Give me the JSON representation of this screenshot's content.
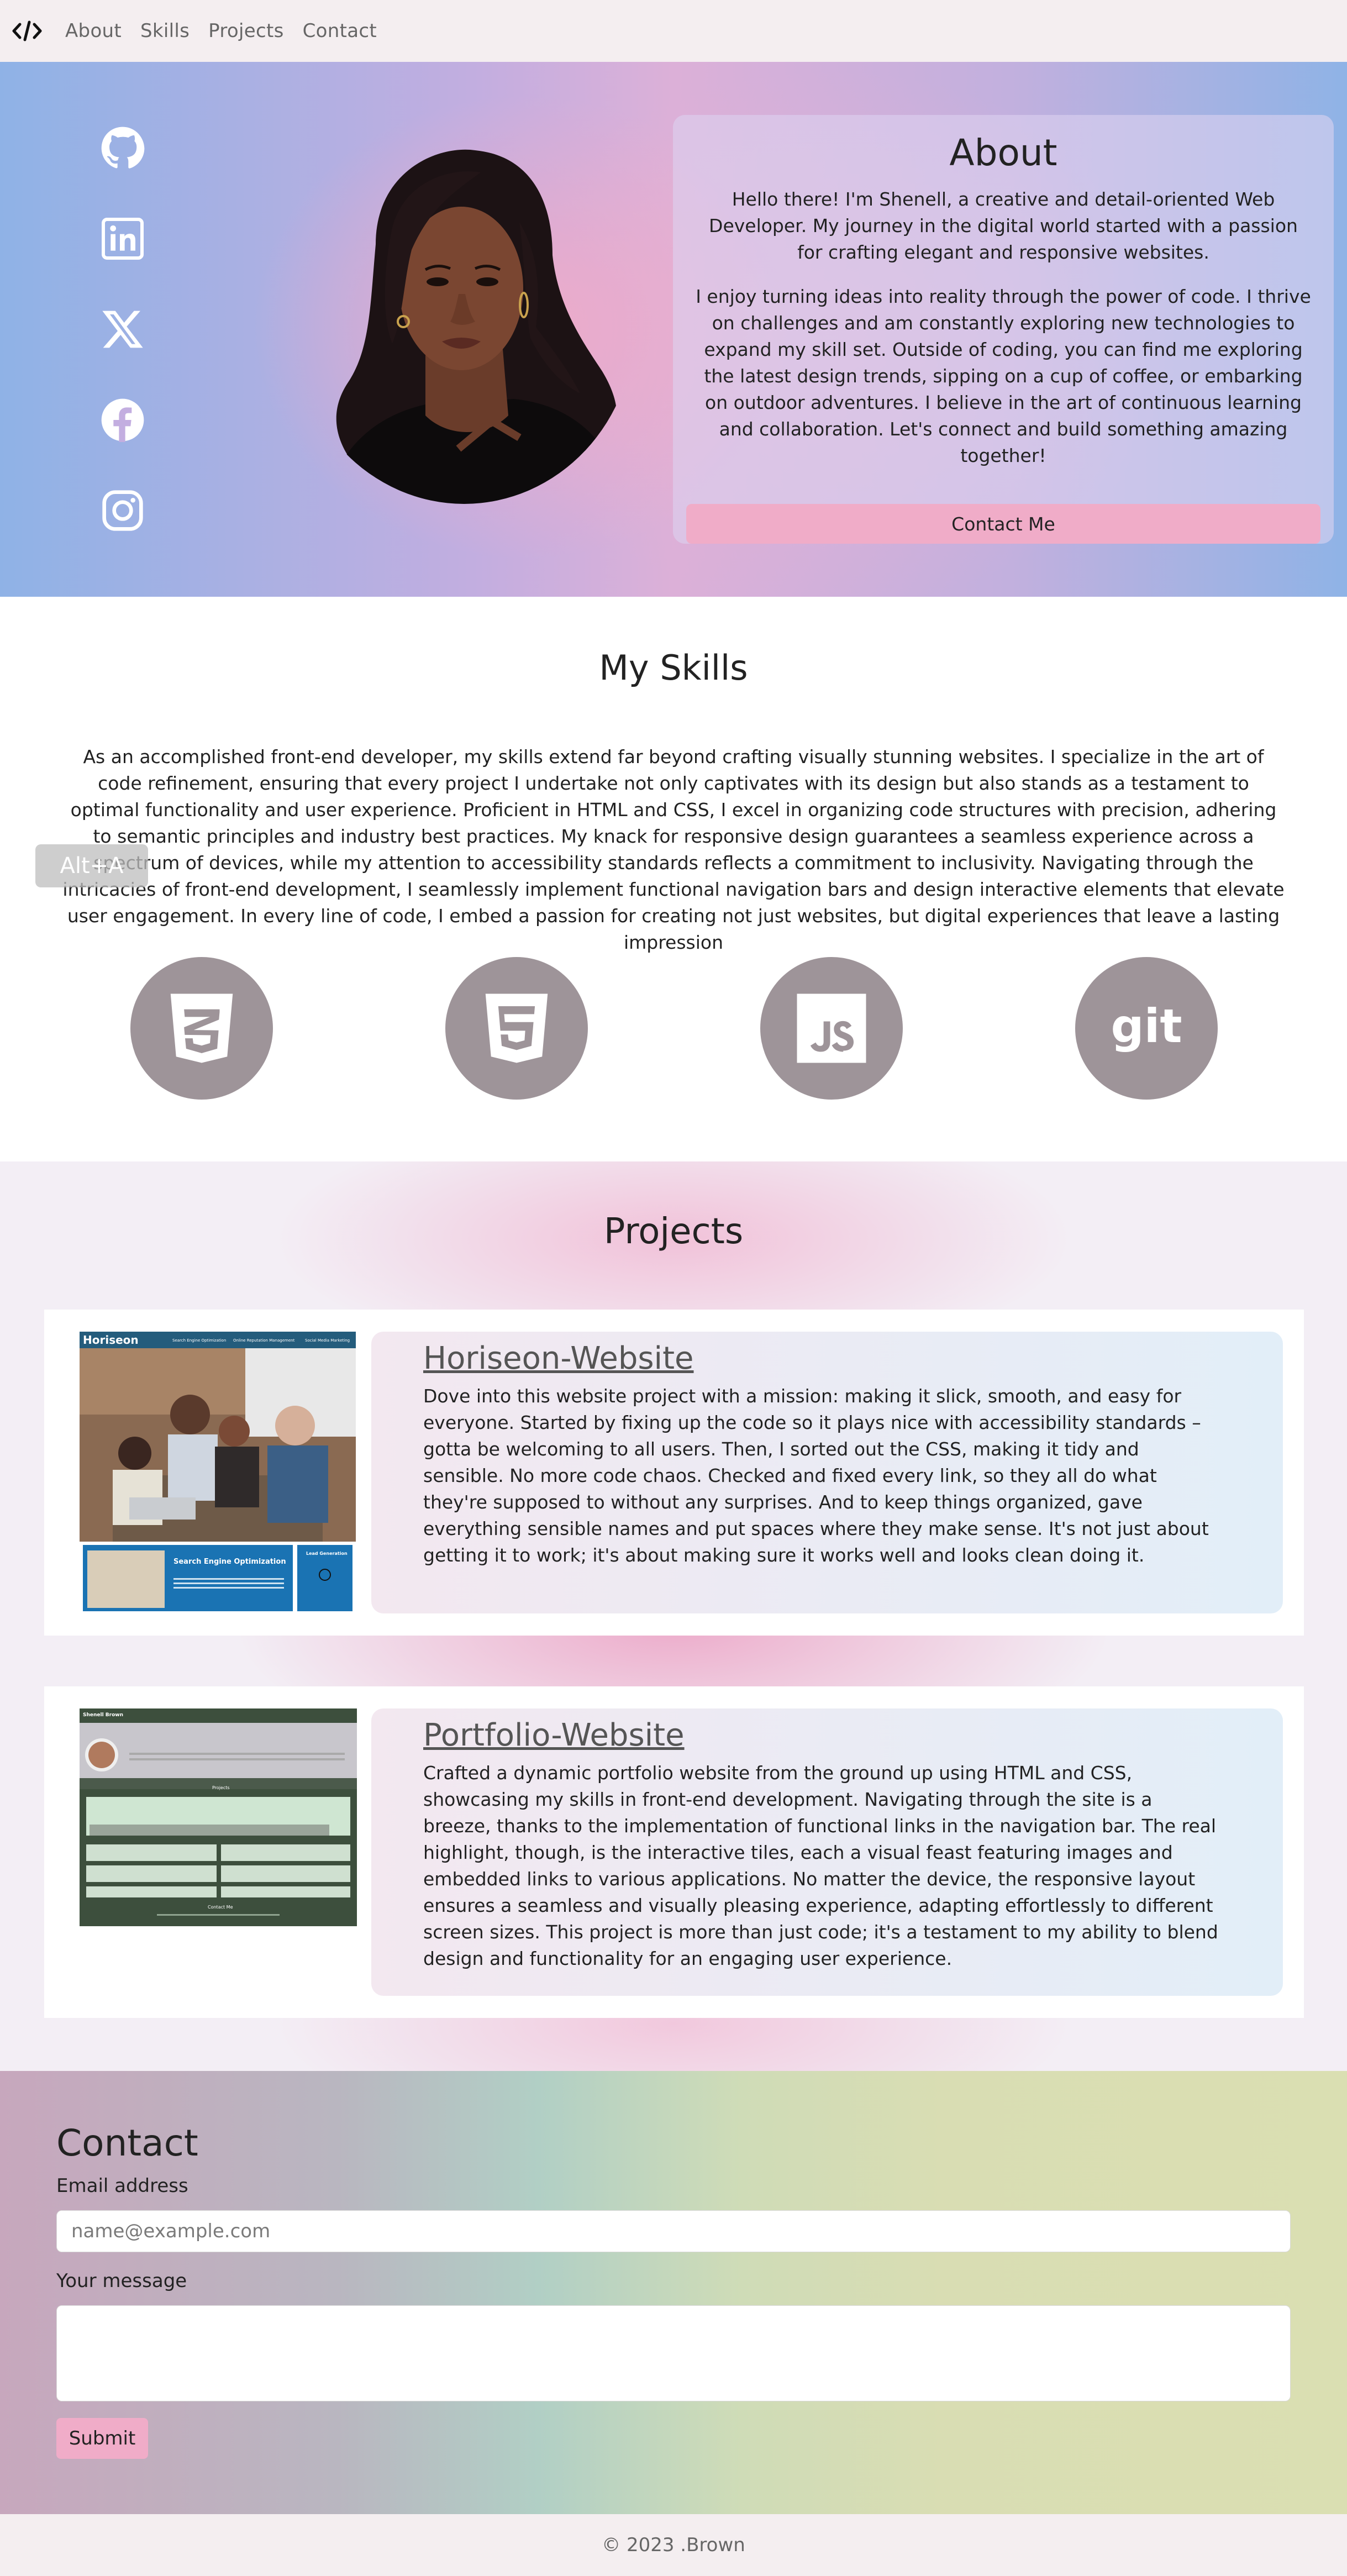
{
  "nav": {
    "logo": "</>",
    "links": [
      "About",
      "Skills",
      "Projects",
      "Contact"
    ]
  },
  "hero": {
    "social_icons": [
      "github-icon",
      "linkedin-icon",
      "x-icon",
      "facebook-icon",
      "instagram-icon"
    ],
    "about_title": "About",
    "about_paragraphs": [
      "Hello there! I'm Shenell, a creative and detail-oriented Web Developer. My journey in the digital world started with a passion for crafting elegant and responsive websites.",
      "I enjoy turning ideas into reality through the power of code. I thrive on challenges and am constantly exploring new technologies to expand my skill set. Outside of coding, you can find me exploring the latest design trends, sipping on a cup of coffee, or embarking on outdoor adventures. I believe in the art of continuous learning and collaboration. Let's connect and build something amazing together!"
    ],
    "contact_button": "Contact Me"
  },
  "skills": {
    "title": "My Skills",
    "text": "As an accomplished front-end developer, my skills extend far beyond crafting visually stunning websites. I specialize in the art of code refinement, ensuring that every project I undertake not only captivates with its design but also stands as a testament to optimal functionality and user experience. Proficient in HTML and CSS, I excel in organizing code structures with precision, adhering to semantic principles and industry best practices. My knack for responsive design guarantees a seamless experience across a spectrum of devices, while my attention to accessibility standards reflects a commitment to inclusivity. Navigating through the intricacies of front-end development, I seamlessly implement functional navigation bars and design interactive elements that elevate user engagement. In every line of code, I embed a passion for creating not just websites, but digital experiences that leave a lasting impression",
    "icons": [
      "css3-icon",
      "html5-icon",
      "javascript-icon",
      "git-icon"
    ],
    "overlay_hint": "Alt+A"
  },
  "projects": {
    "title": "Projects",
    "items": [
      {
        "name": "Horiseon-Website",
        "thumb_brand": "Horiseon",
        "thumb_nav": [
          "Search Engine Optimization",
          "Online Reputation Management",
          "Social Media Marketing"
        ],
        "thumb_feature": "Search Engine Optimization",
        "thumb_side": "Lead Generation",
        "description": "Dove into this website project with a mission: making it slick, smooth, and easy for everyone. Started by fixing up the code so it plays nice with accessibility standards – gotta be welcoming to all users. Then, I sorted out the CSS, making it tidy and sensible. No more code chaos. Checked and fixed every link, so they all do what they're supposed to without any surprises. And to keep things organized, gave everything sensible names and put spaces where they make sense. It's not just about getting it to work; it's about making sure it works well and looks clean doing it."
      },
      {
        "name": "Portfolio-Website",
        "thumb_brand": "Shenell Brown",
        "thumb_section": "Projects",
        "thumb_footer": "Contact Me",
        "description": "Crafted a dynamic portfolio website from the ground up using HTML and CSS, showcasing my skills in front-end development. Navigating through the site is a breeze, thanks to the implementation of functional links in the navigation bar. The real highlight, though, is the interactive tiles, each a visual feast featuring images and embedded links to various applications. No matter the device, the responsive layout ensures a seamless and visually pleasing experience, adapting effortlessly to different screen sizes. This project is more than just code; it's a testament to my ability to blend design and functionality for an engaging user experience."
      }
    ]
  },
  "contact": {
    "title": "Contact",
    "email_label": "Email address",
    "email_placeholder": "name@example.com",
    "message_label": "Your message",
    "submit": "Submit"
  },
  "footer": {
    "text": "© 2023 .Brown"
  },
  "colors": {
    "accent_pink": "#f0acc8",
    "skill_circle": "#9e9499",
    "nav_bg": "#f4eef0"
  }
}
